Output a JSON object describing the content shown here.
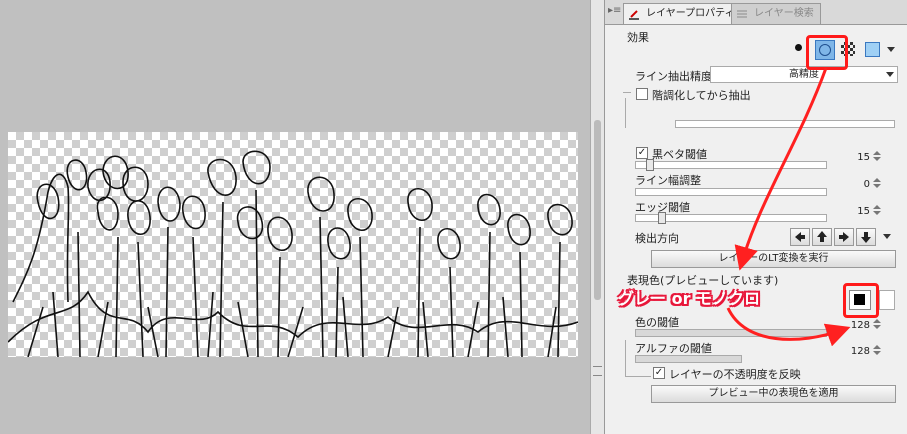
{
  "panel": {
    "tabs": [
      {
        "label": "レイヤープロパティ"
      },
      {
        "label": "レイヤー検索"
      }
    ],
    "effect_section": "効果",
    "line_precision": {
      "label": "ライン抽出精度",
      "value": "高精度"
    },
    "gradation_extract": {
      "label": "階調化してから抽出",
      "checked": false
    },
    "black_fill_threshold": {
      "label": "黒ベタ閾値",
      "checked": true,
      "value": "15"
    },
    "line_width_adjust": {
      "label": "ライン幅調整",
      "value": "0"
    },
    "edge_threshold": {
      "label": "エッジ閾値",
      "value": "15"
    },
    "detect_direction": {
      "label": "検出方向"
    },
    "lt_convert_button": "レイヤーのLT変換を実行",
    "expression_color": {
      "label": "表現色(プレビューしています)"
    },
    "color_threshold": {
      "label": "色の閾値",
      "value": "128"
    },
    "alpha_threshold": {
      "label": "アルファの閾値",
      "value": "128"
    },
    "reflect_opacity": {
      "label": "レイヤーの不透明度を反映",
      "checked": true
    },
    "apply_preview_button": "プレビュー中の表現色を適用"
  },
  "annotation": {
    "text": "グレー or モノクロ",
    "color": "#e8173a"
  }
}
